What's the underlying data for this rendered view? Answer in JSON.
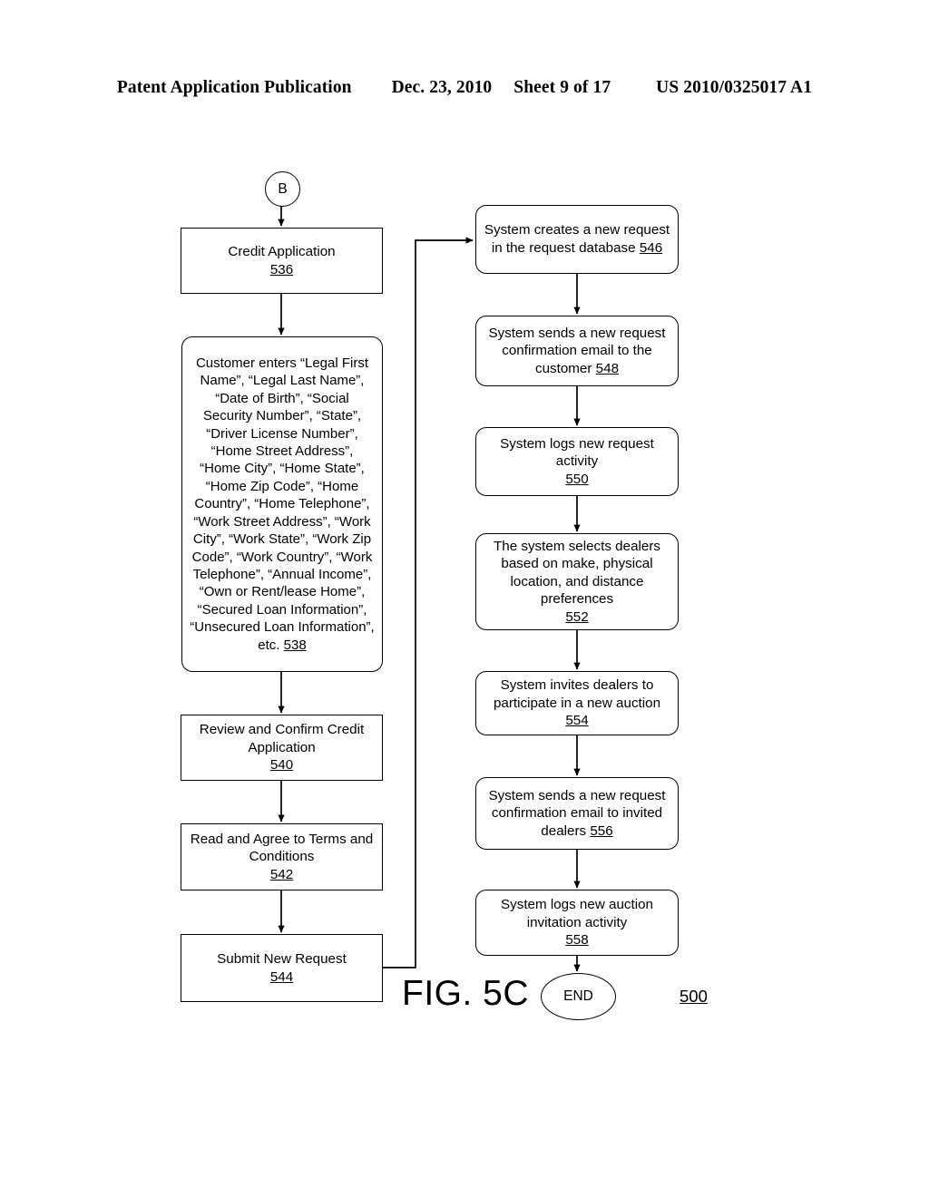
{
  "header": {
    "publication": "Patent Application Publication",
    "date": "Dec. 23, 2010",
    "sheet": "Sheet 9 of 17",
    "patent_number": "US 2010/0325017 A1"
  },
  "figure": {
    "label": "FIG. 5C",
    "number": "500"
  },
  "connectors": {
    "entry_label": "B",
    "end_label": "END"
  },
  "flow": {
    "left_column": [
      {
        "id": "536",
        "text": "Credit Application",
        "ref": "536",
        "shape": "rect"
      },
      {
        "id": "538",
        "text": "Customer enters “Legal First Name”, “Legal Last Name”, “Date of Birth”, “Social Security Number”, “State”, “Driver License Number”, “Home Street Address”, “Home City”, “Home State”, “Home Zip Code”, “Home Country”, “Home Telephone”, “Work Street Address”, “Work City”, “Work State”, “Work Zip Code”, “Work Country”, “Work Telephone”, “Annual Income”, “Own or Rent/lease Home”, “Secured Loan Information”, “Unsecured Loan Information”, etc.",
        "ref": "538",
        "ref_inline": true,
        "shape": "rounded"
      },
      {
        "id": "540",
        "text": "Review and Confirm Credit Application",
        "ref": "540",
        "shape": "rect"
      },
      {
        "id": "542",
        "text": "Read and Agree to Terms and Conditions",
        "ref": "542",
        "shape": "rect"
      },
      {
        "id": "544",
        "text": "Submit New Request",
        "ref": "544",
        "shape": "rect"
      }
    ],
    "right_column": [
      {
        "id": "546",
        "text": "System creates a new request in the request database",
        "ref": "546",
        "ref_inline": true,
        "shape": "rounded"
      },
      {
        "id": "548",
        "text": "System sends a new request confirmation email to the customer",
        "ref": "548",
        "ref_inline": true,
        "shape": "rounded"
      },
      {
        "id": "550",
        "text": "System logs new request activity",
        "ref": "550",
        "shape": "rounded"
      },
      {
        "id": "552",
        "text": "The system selects dealers based on make, physical location, and distance preferences",
        "ref": "552",
        "shape": "rounded"
      },
      {
        "id": "554",
        "text": "System invites dealers to participate in a new auction",
        "ref": "554",
        "shape": "rounded"
      },
      {
        "id": "556",
        "text": "System sends a new request confirmation email to invited dealers",
        "ref": "556",
        "ref_inline": true,
        "shape": "rounded"
      },
      {
        "id": "558",
        "text": "System logs new auction invitation activity",
        "ref": "558",
        "shape": "rounded"
      }
    ]
  }
}
